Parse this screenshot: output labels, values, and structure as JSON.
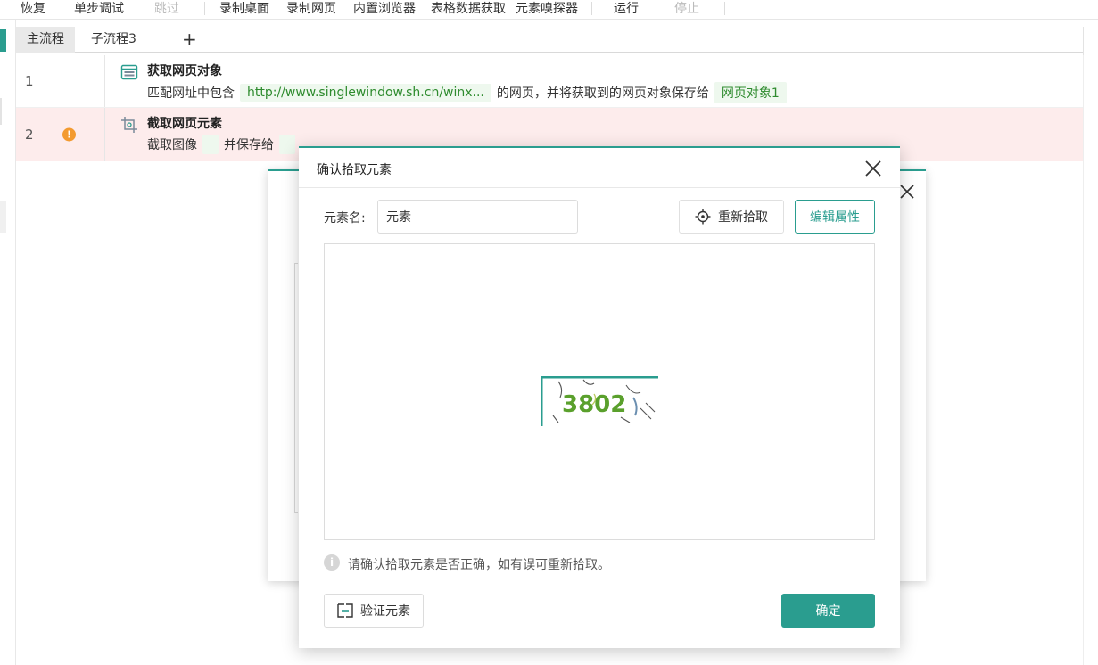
{
  "toolbar": {
    "items": [
      {
        "label": "恢复",
        "enabled": true
      },
      {
        "label": "单步调试",
        "enabled": true
      },
      {
        "label": "跳过",
        "enabled": false
      },
      {
        "label": "录制桌面",
        "enabled": true
      },
      {
        "label": "录制网页",
        "enabled": true
      },
      {
        "label": "内置浏览器",
        "enabled": true
      },
      {
        "label": "表格数据获取",
        "enabled": true
      },
      {
        "label": "元素嗅探器",
        "enabled": true
      },
      {
        "label": "运行",
        "enabled": true
      },
      {
        "label": "停止",
        "enabled": false
      }
    ]
  },
  "tabs": {
    "items": [
      {
        "label": "主流程",
        "active": true
      },
      {
        "label": "子流程3",
        "active": false
      }
    ],
    "add_label": "+"
  },
  "steps": [
    {
      "line": "1",
      "title": "获取网页对象",
      "icon": "web-page-icon",
      "desc_prefix": "匹配网址中包含",
      "url_chip": "http://www.singlewindow.sh.cn/winx...",
      "desc_middle": "的网页，并将获取到的网页对象保存给",
      "var_chip": "网页对象1"
    },
    {
      "line": "2",
      "title": "截取网页元素",
      "icon": "crop-image-icon",
      "status": "warning",
      "warning_glyph": "!",
      "desc_prefix": "截取图像",
      "desc_middle": "并保存给"
    }
  ],
  "dialog": {
    "title": "确认拾取元素",
    "name_label": "元素名:",
    "name_value": "元素",
    "repick_label": "重新拾取",
    "edit_label": "编辑属性",
    "captcha_text": "3802",
    "hint_glyph": "i",
    "hint": "请确认拾取元素是否正确，如有误可重新拾取。",
    "verify_label": "验证元素",
    "ok_label": "确定"
  },
  "colors": {
    "accent": "#2a9d8f",
    "warning": "#f39a2f",
    "error_row_bg": "#fdecec",
    "chip_bg": "#eef8ee",
    "chip_text": "#2e8b2e"
  }
}
